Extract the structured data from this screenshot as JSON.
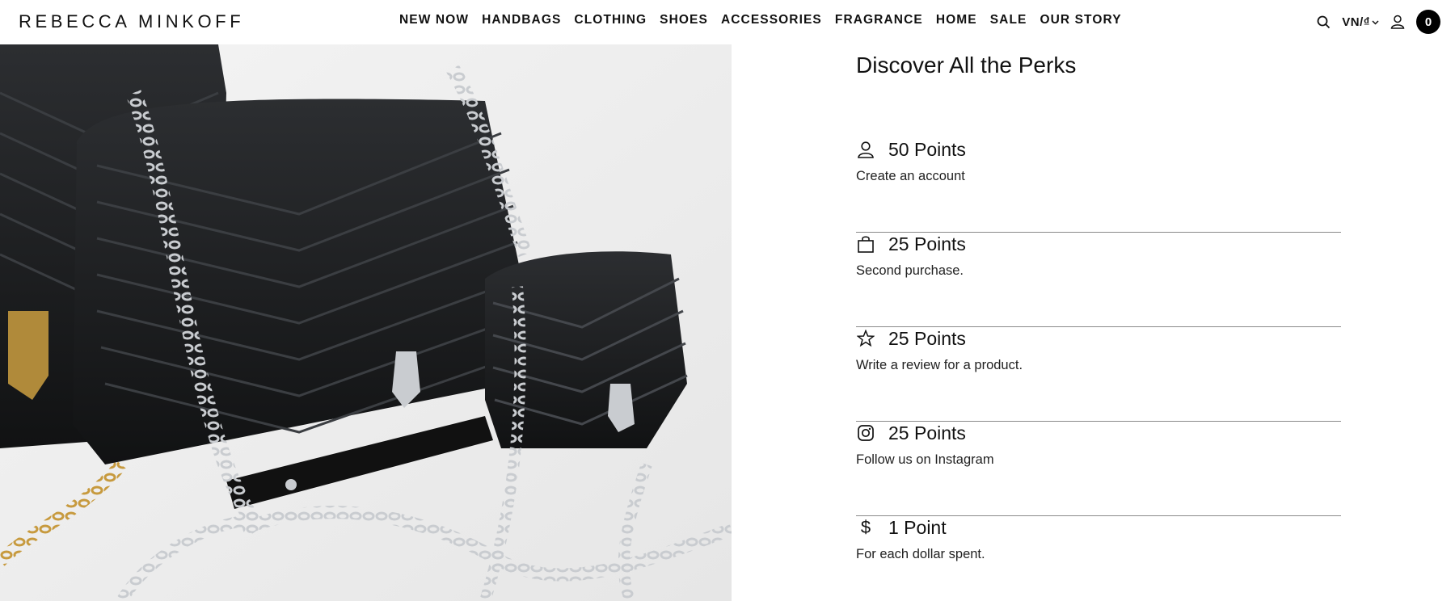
{
  "header": {
    "logo": "REBECCA MINKOFF",
    "nav": [
      "NEW NOW",
      "HANDBAGS",
      "CLOTHING",
      "SHOES",
      "ACCESSORIES",
      "FRAGRANCE",
      "HOME",
      "SALE",
      "OUR STORY"
    ],
    "locale": "VN/₫",
    "cart_count": "0",
    "icons": {
      "search": "search-icon",
      "account": "user-icon",
      "locale": "chevron-down-icon"
    }
  },
  "hero": {
    "image": "black quilted chevron leather handbags with silver and gold chains"
  },
  "perks": {
    "title": "Discover All the Perks",
    "items": [
      {
        "icon": "user-icon",
        "points": "50 Points",
        "desc": "Create an account"
      },
      {
        "icon": "shopping-bag-icon",
        "points": "25 Points",
        "desc": "Second purchase."
      },
      {
        "icon": "star-icon",
        "points": "25 Points",
        "desc": "Write a review for a product."
      },
      {
        "icon": "instagram-icon",
        "points": "25 Points",
        "desc": "Follow us on Instagram"
      },
      {
        "icon": "dollar-icon",
        "points": "1 Point",
        "desc": "For each dollar spent."
      }
    ]
  },
  "colors": {
    "text": "#111111",
    "divider": "#8a8a8a",
    "cart_badge": "#000000"
  }
}
